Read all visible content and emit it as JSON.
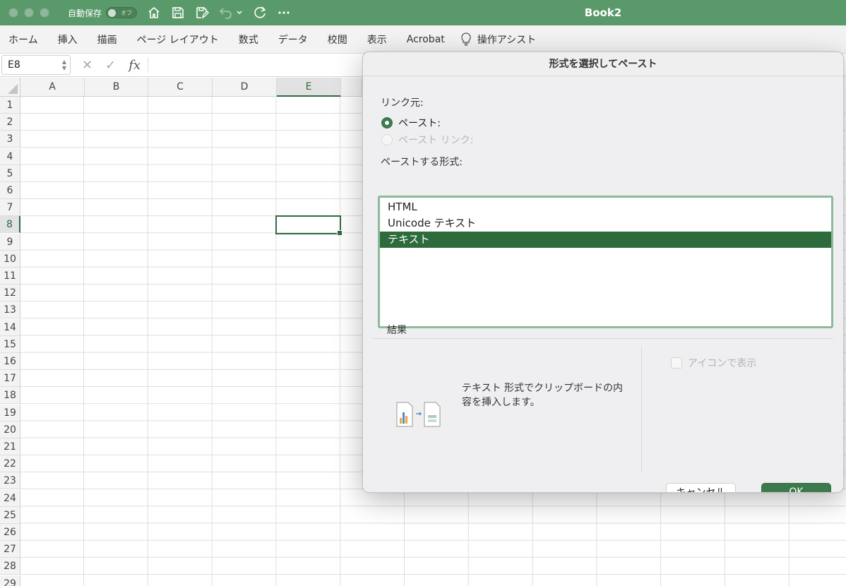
{
  "titlebar": {
    "autosave_label": "自動保存",
    "autosave_state": "オフ",
    "book_title": "Book2"
  },
  "ribbon": {
    "tabs": [
      "ホーム",
      "挿入",
      "描画",
      "ページ レイアウト",
      "数式",
      "データ",
      "校閲",
      "表示",
      "Acrobat"
    ],
    "assist_label": "操作アシスト"
  },
  "formula_bar": {
    "namebox": "E8",
    "fx": "fx"
  },
  "grid": {
    "columns": [
      "A",
      "B",
      "C",
      "D",
      "E"
    ],
    "rows": [
      "1",
      "2",
      "3",
      "4",
      "5",
      "6",
      "7",
      "8",
      "9",
      "10",
      "11",
      "12",
      "13",
      "14",
      "15",
      "16",
      "17",
      "18",
      "19",
      "20",
      "21",
      "22",
      "23",
      "24",
      "25",
      "26",
      "27",
      "28",
      "29"
    ],
    "selected_column": "E",
    "selected_row": "8",
    "active_cell": "E8"
  },
  "dialog": {
    "title": "形式を選択してペースト",
    "link_source_label": "リンク元:",
    "radio_paste": "ペースト:",
    "radio_paste_link": "ペースト リンク:",
    "format_label": "ペーストする形式:",
    "formats": [
      "HTML",
      "Unicode テキスト",
      "テキスト"
    ],
    "selected_format": "テキスト",
    "result_label": "結果",
    "result_text": "テキスト 形式でクリップボードの内容を挿入します。",
    "show_as_icon": "アイコンで表示",
    "cancel_button": "キャンセル",
    "ok_button": "OK"
  },
  "colors": {
    "titlebar": "#5a9a6a",
    "accent": "#2d6b3c",
    "ok_button": "#3c7a4d"
  }
}
